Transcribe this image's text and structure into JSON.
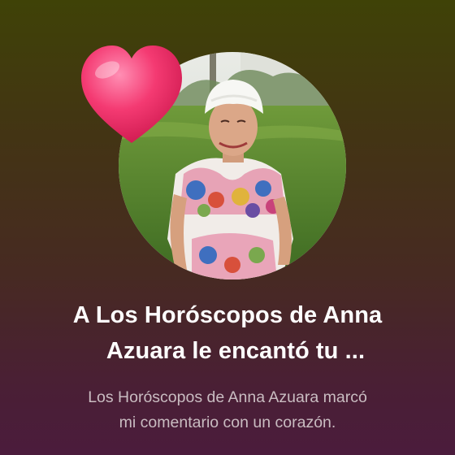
{
  "notification": {
    "title_line1": "A Los Horóscopos de Anna",
    "title_line2": "Azuara le encantó tu ...",
    "body_line1": "Los Horóscopos de Anna Azuara marcó",
    "body_line2": "mi comentario con un corazón."
  },
  "reaction": {
    "icon": "heart-icon",
    "color": "#f0306c"
  },
  "colors": {
    "background_top": "#3f4207",
    "background_bottom": "#4b1c3c",
    "title": "#ffffff",
    "body": "#c9bcc1"
  }
}
